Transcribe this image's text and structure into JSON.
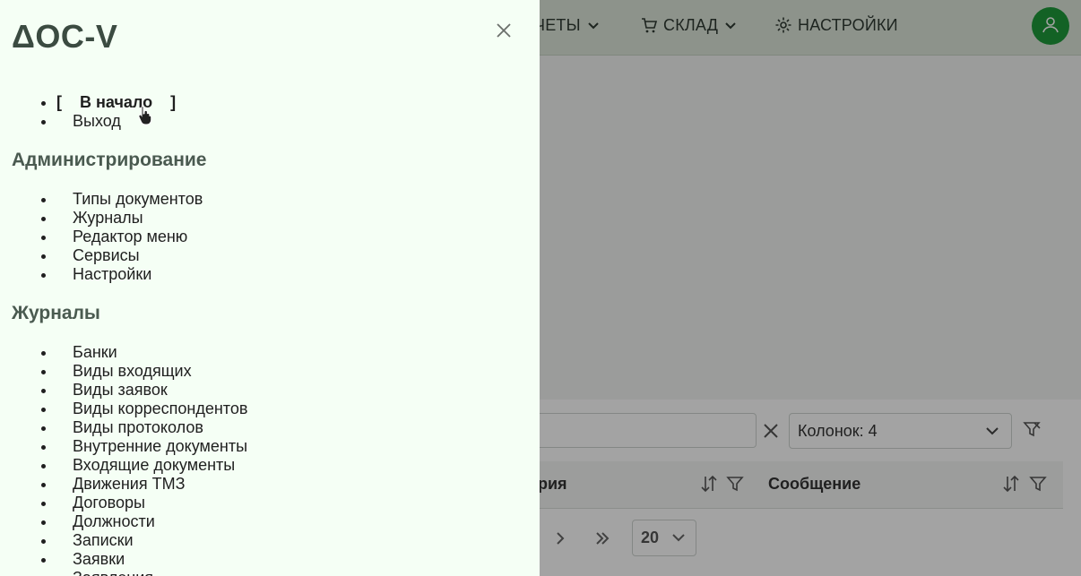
{
  "topnav": {
    "reports_label": "ЧЕТЫ",
    "warehouse_label": "СКЛАД",
    "settings_label": "НАСТРОЙКИ"
  },
  "toolbar": {
    "columns_select_value": "Колонок: 4"
  },
  "table": {
    "columns": [
      "рия",
      "Сообщение"
    ]
  },
  "pager": {
    "page_size": "20"
  },
  "drawer": {
    "logo": "ΔOC-V",
    "top_links": {
      "bracket_open": "[",
      "home": "В начало",
      "bracket_close": "]",
      "logout": "Выход"
    },
    "admin_title": "Администрирование",
    "admin_items": [
      "Типы документов",
      "Журналы",
      "Редактор меню",
      "Сервисы",
      "Настройки"
    ],
    "journals_title": "Журналы",
    "journal_items": [
      "Банки",
      "Виды входящих",
      "Виды заявок",
      "Виды корреспондентов",
      "Виды протоколов",
      "Внутренние документы",
      "Входящие документы",
      "Движения ТМЗ",
      "Договоры",
      "Должности",
      "Записки",
      "Заявки",
      "Заявления"
    ]
  },
  "colors": {
    "drawer_bg": "#f5fff5",
    "avatar_bg": "#1f9a3a",
    "overlay": "rgba(0,0,0,0.36)"
  }
}
